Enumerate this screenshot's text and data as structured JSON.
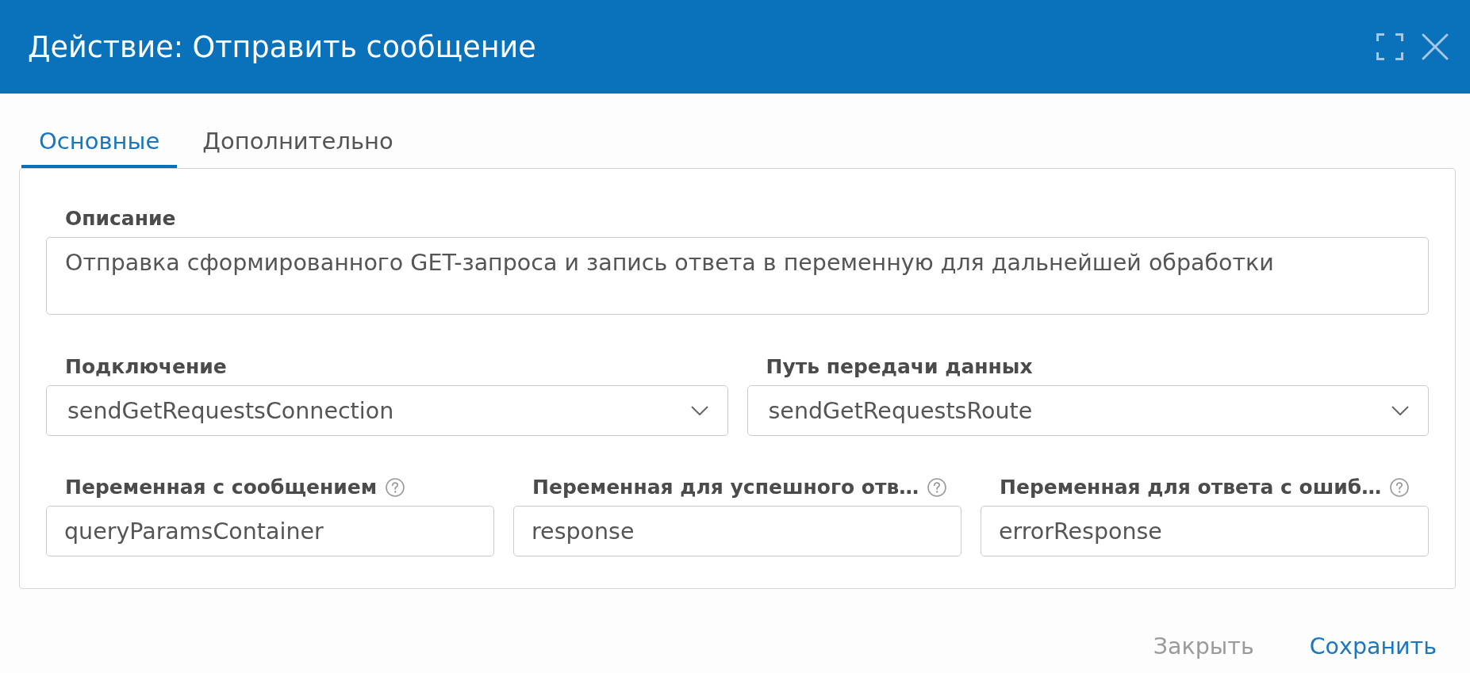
{
  "dialog": {
    "title": "Действие: Отправить сообщение"
  },
  "tabs": [
    {
      "label": "Основные",
      "selected": true
    },
    {
      "label": "Дополнительно",
      "selected": false
    }
  ],
  "form": {
    "description": {
      "label": "Описание",
      "value": "Отправка сформированного GET-запроса и запись ответа в переменную для дальнейшей обработки"
    },
    "rows": [
      {
        "fields": [
          {
            "kind": "select",
            "label": "Подключение",
            "value": "sendGetRequestsConnection",
            "help": false
          },
          {
            "kind": "select",
            "label": "Путь передачи данных",
            "value": "sendGetRequestsRoute",
            "help": false
          }
        ]
      },
      {
        "fields": [
          {
            "kind": "input",
            "label": "Переменная с сообщением",
            "value": "queryParamsContainer",
            "help": true
          },
          {
            "kind": "input",
            "label": "Переменная для успешного отв…",
            "value": "response",
            "help": true
          },
          {
            "kind": "input",
            "label": "Переменная для ответа с ошиб…",
            "value": "errorResponse",
            "help": true
          }
        ]
      }
    ]
  },
  "footer": {
    "buttons": [
      {
        "label": "Закрыть",
        "kind": "secondary"
      },
      {
        "label": "Сохранить",
        "kind": "primary"
      }
    ]
  }
}
